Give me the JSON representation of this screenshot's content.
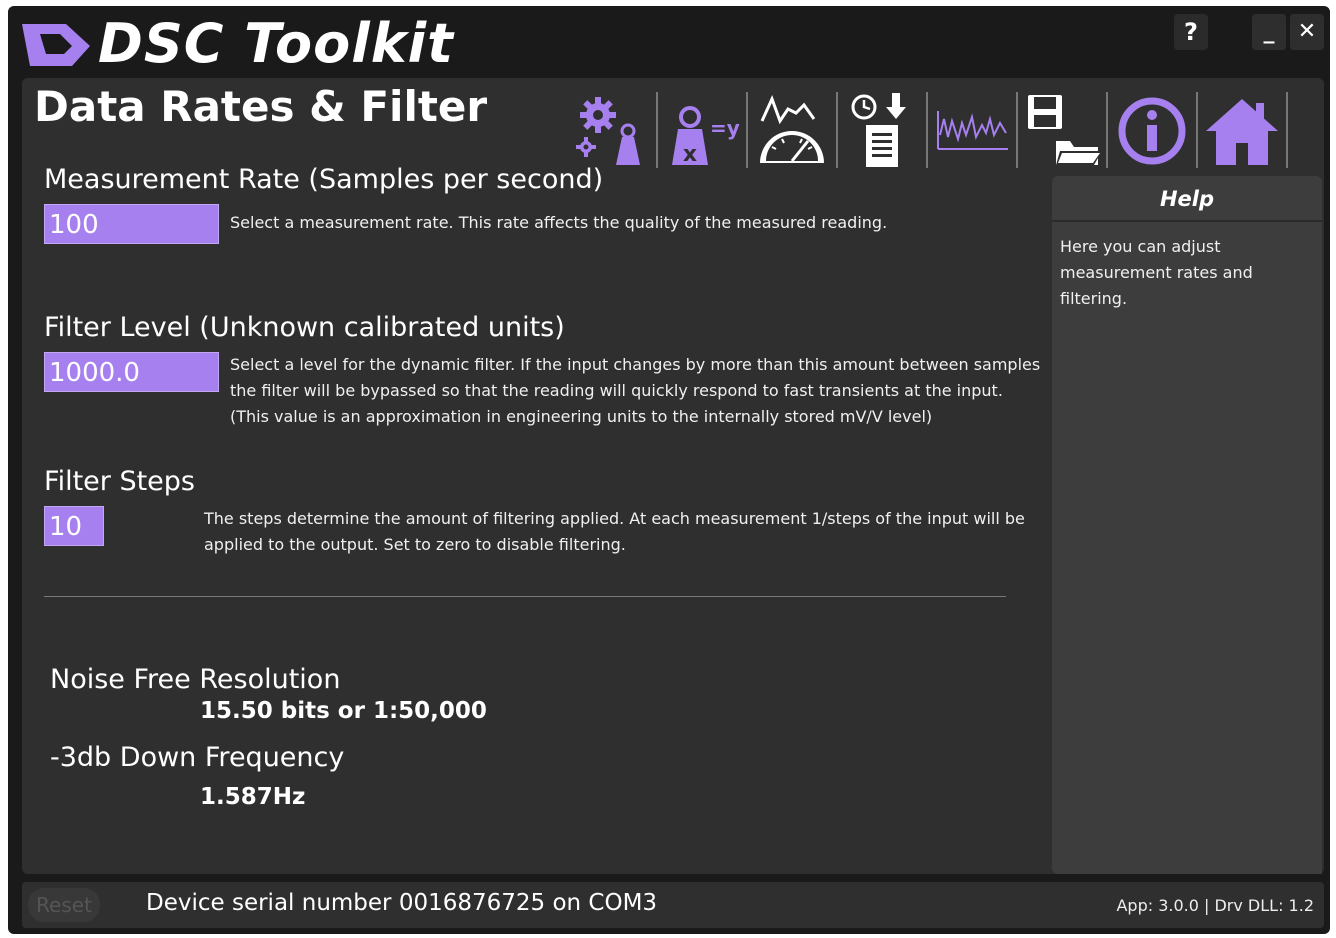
{
  "window": {
    "app_title": "DSC Toolkit",
    "help_label": "?",
    "minimize_label": "_",
    "close_label": "✕"
  },
  "page": {
    "title": "Data Rates & Filter"
  },
  "toolbar": {
    "tools": [
      {
        "name": "settings-tool",
        "icon": "gears-weight-icon"
      },
      {
        "name": "calibration-tool",
        "icon": "x-equals-y-icon"
      },
      {
        "name": "gauge-tool",
        "icon": "gauge-graph-icon"
      },
      {
        "name": "logging-tool",
        "icon": "clock-download-document-icon"
      },
      {
        "name": "chart-tool",
        "icon": "waveform-icon"
      },
      {
        "name": "save-load-tool",
        "icon": "disk-folder-icon"
      },
      {
        "name": "info-tool",
        "icon": "info-icon"
      },
      {
        "name": "home-tool",
        "icon": "home-icon"
      }
    ],
    "x_label": "x",
    "y_label": "=y"
  },
  "measurement_rate": {
    "label": "Measurement Rate (Samples per second)",
    "value": "100",
    "description": "Select a measurement rate. This rate affects the quality of the measured reading."
  },
  "filter_level": {
    "label": "Filter Level (Unknown calibrated units)",
    "value": "1000.0",
    "description_lines": [
      "Select a level for the dynamic filter. If the input changes by more than this amount between samples",
      "the filter will be bypassed so that the reading will quickly respond to fast transients at the input.",
      "(This value is an approximation in engineering units to the internally stored mV/V level)"
    ]
  },
  "filter_steps": {
    "label": "Filter Steps",
    "value": "10",
    "description_lines": [
      "The steps determine the amount of filtering applied. At each measurement 1/steps of the input will be",
      "applied to the output. Set to zero to disable filtering."
    ]
  },
  "results": {
    "noise_label": "Noise Free Resolution",
    "noise_value": "15.50 bits or 1:50,000",
    "freq_label": "-3db Down Frequency",
    "freq_value": "1.587Hz"
  },
  "help": {
    "title": "Help",
    "text": "Here you can adjust measurement rates and filtering."
  },
  "status": {
    "reset_label": "Reset",
    "serial_text": "Device serial number 0016876725 on COM3",
    "version_text": "App: 3.0.0 | Drv DLL: 1.2"
  },
  "colors": {
    "accent": "#a680ee",
    "background": "#2f2f2f",
    "titlebar": "#1a1a1a",
    "help_panel": "#3d3d3d"
  }
}
